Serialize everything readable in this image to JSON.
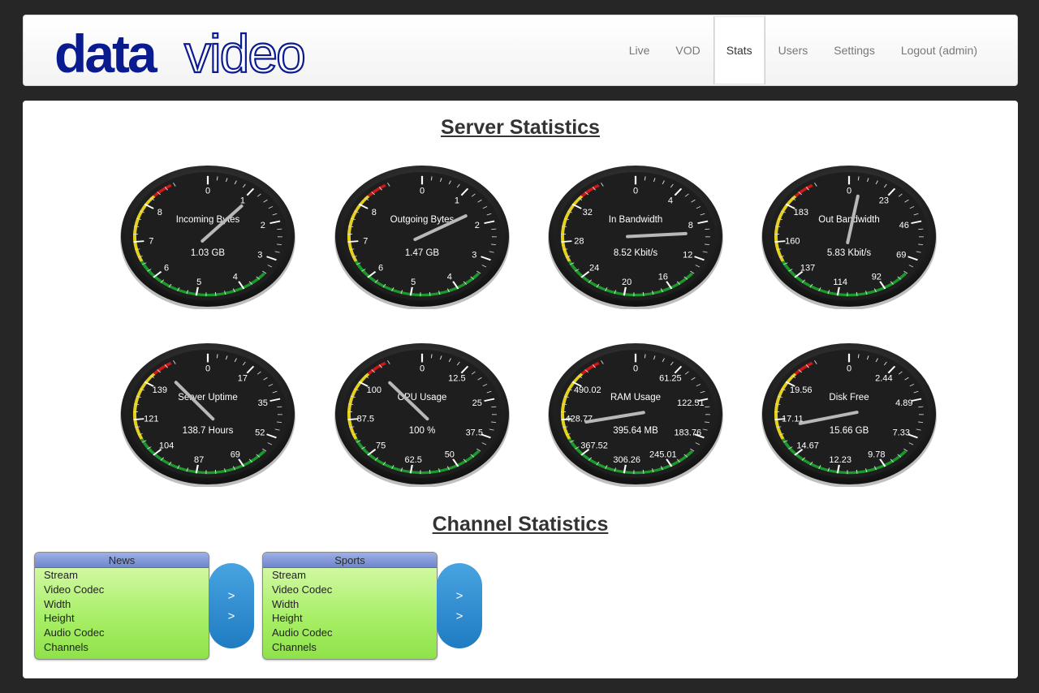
{
  "logo": {
    "text_bold": "data",
    "text_light": "video",
    "color": "#0a1b8f"
  },
  "nav": [
    {
      "label": "Live",
      "active": false
    },
    {
      "label": "VOD",
      "active": false
    },
    {
      "label": "Stats",
      "active": true
    },
    {
      "label": "Users",
      "active": false
    },
    {
      "label": "Settings",
      "active": false
    },
    {
      "label": "Logout (admin)",
      "active": false
    }
  ],
  "server_stats": {
    "title": "Server Statistics",
    "gauges": [
      {
        "id": "incoming-bytes",
        "label": "Incoming Bytes",
        "value_text": "1.03 GB",
        "ticks": [
          "0",
          "1",
          "2",
          "3",
          "4",
          "5",
          "6",
          "7",
          "8"
        ],
        "needle_fraction": 0.117
      },
      {
        "id": "outgoing-bytes",
        "label": "Outgoing Bytes",
        "value_text": "1.47 GB",
        "ticks": [
          "0",
          "1",
          "2",
          "3",
          "4",
          "5",
          "6",
          "7",
          "8"
        ],
        "needle_fraction": 0.167
      },
      {
        "id": "in-bandwidth",
        "label": "In Bandwidth",
        "value_text": "8.52 Kbit/s",
        "ticks": [
          "0",
          "4",
          "8",
          "12",
          "16",
          "20",
          "24",
          "28",
          "32"
        ],
        "needle_fraction": 0.24
      },
      {
        "id": "out-bandwidth",
        "label": "Out Bandwidth",
        "value_text": "5.83 Kbit/s",
        "ticks": [
          "0",
          "23",
          "46",
          "69",
          "92",
          "114",
          "137",
          "160",
          "183"
        ],
        "needle_fraction": 0.028
      },
      {
        "id": "server-uptime",
        "label": "Server Uptime",
        "value_text": "138.7 Hours",
        "ticks": [
          "0",
          "17",
          "35",
          "52",
          "69",
          "87",
          "104",
          "121",
          "139"
        ],
        "needle_fraction": 0.891
      },
      {
        "id": "cpu-usage",
        "label": "CPU Usage",
        "value_text": "100 %",
        "ticks": [
          "0",
          "12.5",
          "25",
          "37.5",
          "50",
          "62.5",
          "75",
          "87.5",
          "100"
        ],
        "needle_fraction": 0.889
      },
      {
        "id": "ram-usage",
        "label": "RAM Usage",
        "value_text": "395.64 MB",
        "ticks": [
          "0",
          "61.25",
          "122.51",
          "183.76",
          "245.01",
          "306.26",
          "367.52",
          "428.77",
          "490.02"
        ],
        "needle_fraction": 0.718
      },
      {
        "id": "disk-free",
        "label": "Disk Free",
        "value_text": "15.66 GB",
        "ticks": [
          "0",
          "2.44",
          "4.89",
          "7.33",
          "9.78",
          "12.23",
          "14.67",
          "17.11",
          "19.56"
        ],
        "needle_fraction": 0.712
      }
    ]
  },
  "channel_stats": {
    "title": "Channel Statistics",
    "channels": [
      {
        "name": "News",
        "rows": [
          "Stream",
          "Video Codec",
          "Width",
          "Height",
          "Audio Codec",
          "Channels"
        ],
        "buttons": [
          ">",
          ">"
        ]
      },
      {
        "name": "Sports",
        "rows": [
          "Stream",
          "Video Codec",
          "Width",
          "Height",
          "Audio Codec",
          "Channels"
        ],
        "buttons": [
          ">",
          ">"
        ]
      }
    ]
  },
  "colors": {
    "gauge_face": "#1e1e1e",
    "gauge_zone_red": "#d01818",
    "gauge_zone_yellow": "#e6d21a",
    "gauge_zone_green": "#1a9a2a",
    "channel_button": "#2a8bd0"
  }
}
